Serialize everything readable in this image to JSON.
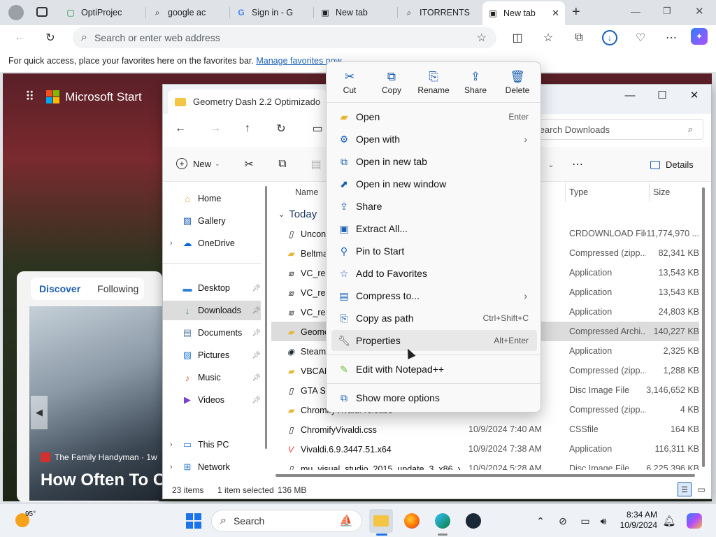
{
  "browser": {
    "tabs": [
      {
        "title": "OptiProjec",
        "icon": "sheet-icon"
      },
      {
        "title": "google ac",
        "icon": "search-icon"
      },
      {
        "title": "Sign in - G",
        "icon": "google-icon"
      },
      {
        "title": "New tab",
        "icon": "newtab-icon"
      },
      {
        "title": "ITORRENTS",
        "icon": "search-icon"
      },
      {
        "title": "New tab",
        "icon": "newtab-icon",
        "active": true
      }
    ],
    "address_placeholder": "Search or enter web address",
    "favbar_text": "For quick access, place your favorites here on the favorites bar.",
    "favbar_link": "Manage favorites now"
  },
  "newtab": {
    "brand": "Microsoft Start",
    "feed_tabs": [
      "Discover",
      "Following"
    ],
    "news_source": "The Family Handyman · 1w",
    "news_headline": "How Often To C"
  },
  "explorer": {
    "tab_title": "Geometry Dash 2.2 Optimizado",
    "search_placeholder": "Search Downloads",
    "cmd_new": "New",
    "cmd_details": "Details",
    "nav": [
      {
        "label": "Home",
        "icon": "home-icon"
      },
      {
        "label": "Gallery",
        "icon": "gallery-icon"
      },
      {
        "label": "OneDrive",
        "icon": "cloud-icon",
        "expand": true
      },
      {
        "label": "Desktop",
        "icon": "desktop-icon",
        "pin": true
      },
      {
        "label": "Downloads",
        "icon": "download-icon",
        "pin": true,
        "selected": true
      },
      {
        "label": "Documents",
        "icon": "document-icon",
        "pin": true
      },
      {
        "label": "Pictures",
        "icon": "picture-icon",
        "pin": true
      },
      {
        "label": "Music",
        "icon": "music-icon",
        "pin": true
      },
      {
        "label": "Videos",
        "icon": "video-icon",
        "pin": true
      },
      {
        "label": "This PC",
        "icon": "pc-icon",
        "expand": true
      },
      {
        "label": "Network",
        "icon": "network-icon",
        "expand": true
      }
    ],
    "columns": {
      "name": "Name",
      "type": "Type",
      "size": "Size"
    },
    "group": "Today",
    "files": [
      {
        "name": "Uncon",
        "date": "",
        "type": "CRDOWNLOAD File",
        "size": "11,774,970 ..."
      },
      {
        "name": "Beltma",
        "date": "",
        "type": "Compressed (zipp...",
        "size": "82,341 KB"
      },
      {
        "name": "VC_red",
        "date": "",
        "type": "Application",
        "size": "13,543 KB"
      },
      {
        "name": "VC_red",
        "date": "",
        "type": "Application",
        "size": "13,543 KB"
      },
      {
        "name": "VC_red",
        "date": "",
        "type": "Application",
        "size": "24,803 KB"
      },
      {
        "name": "Geome",
        "date": "",
        "type": "Compressed Archi...",
        "size": "140,227 KB",
        "selected": true
      },
      {
        "name": "SteamS",
        "date": "",
        "type": "Application",
        "size": "2,325 KB"
      },
      {
        "name": "VBCAB",
        "date": "",
        "type": "Compressed (zipp...",
        "size": "1,288 KB"
      },
      {
        "name": "GTA Sa",
        "date": "",
        "type": "Disc Image File",
        "size": "3,146,652 KB"
      },
      {
        "name": "ChromifyVivaldi-release",
        "date": "",
        "type": "Compressed (zipp...",
        "size": "4 KB"
      },
      {
        "name": "ChromifyVivaldi.css",
        "date": "10/9/2024 7:40 AM",
        "type": "CSSfile",
        "size": "164 KB"
      },
      {
        "name": "Vivaldi.6.9.3447.51.x64",
        "date": "10/9/2024 7:38 AM",
        "type": "Application",
        "size": "116,311 KB"
      },
      {
        "name": "mu_visual_studio_2015_update_3_x86_x64",
        "date": "10/9/2024 5:28 AM",
        "type": "Disc Image File",
        "size": "6,225,396 KB"
      }
    ],
    "status": {
      "count": "23 items",
      "selected": "1 item selected",
      "size": "136 MB"
    }
  },
  "context_menu": {
    "quick": [
      {
        "label": "Cut",
        "icon": "scissors-icon"
      },
      {
        "label": "Copy",
        "icon": "copy-icon"
      },
      {
        "label": "Rename",
        "icon": "rename-icon"
      },
      {
        "label": "Share",
        "icon": "share-icon"
      },
      {
        "label": "Delete",
        "icon": "trash-icon"
      }
    ],
    "items": [
      {
        "label": "Open",
        "shortcut": "Enter",
        "icon": "folder-icon"
      },
      {
        "label": "Open with",
        "shortcut": "",
        "icon": "openwith-icon",
        "submenu": true
      },
      {
        "label": "Open in new tab",
        "shortcut": "",
        "icon": "newtab-icon"
      },
      {
        "label": "Open in new window",
        "shortcut": "",
        "icon": "newwindow-icon"
      },
      {
        "label": "Share",
        "shortcut": "",
        "icon": "share-icon"
      },
      {
        "label": "Extract All...",
        "shortcut": "",
        "icon": "extract-icon"
      },
      {
        "label": "Pin to Start",
        "shortcut": "",
        "icon": "pin-icon"
      },
      {
        "label": "Add to Favorites",
        "shortcut": "",
        "icon": "star-icon"
      },
      {
        "label": "Compress to...",
        "shortcut": "",
        "icon": "compress-icon",
        "submenu": true
      },
      {
        "label": "Copy as path",
        "shortcut": "Ctrl+Shift+C",
        "icon": "path-icon"
      },
      {
        "label": "Properties",
        "shortcut": "Alt+Enter",
        "icon": "wrench-icon",
        "hover": true
      }
    ],
    "extra": [
      {
        "label": "Edit with Notepad++",
        "icon": "notepad-icon"
      },
      {
        "label": "Show more options",
        "icon": "more-options-icon"
      }
    ]
  },
  "taskbar": {
    "weather": "95°",
    "search": "Search",
    "time": "8:34 AM",
    "date": "10/9/2024"
  }
}
